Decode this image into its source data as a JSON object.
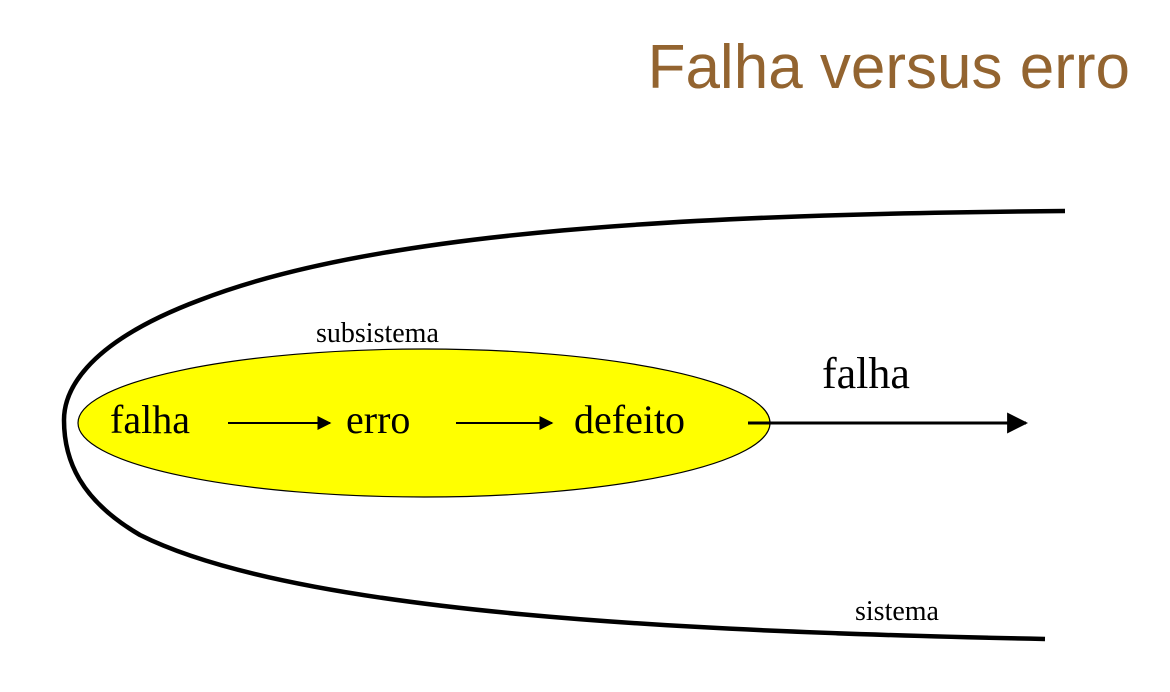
{
  "title": "Falha versus erro",
  "diagram": {
    "outer_label": "sistema",
    "inner_label": "subsistema",
    "chain": [
      "falha",
      "erro",
      "defeito"
    ],
    "output_label": "falha",
    "colors": {
      "title": "#936430",
      "ellipse_fill": "#ffff00",
      "stroke": "#000000"
    }
  }
}
